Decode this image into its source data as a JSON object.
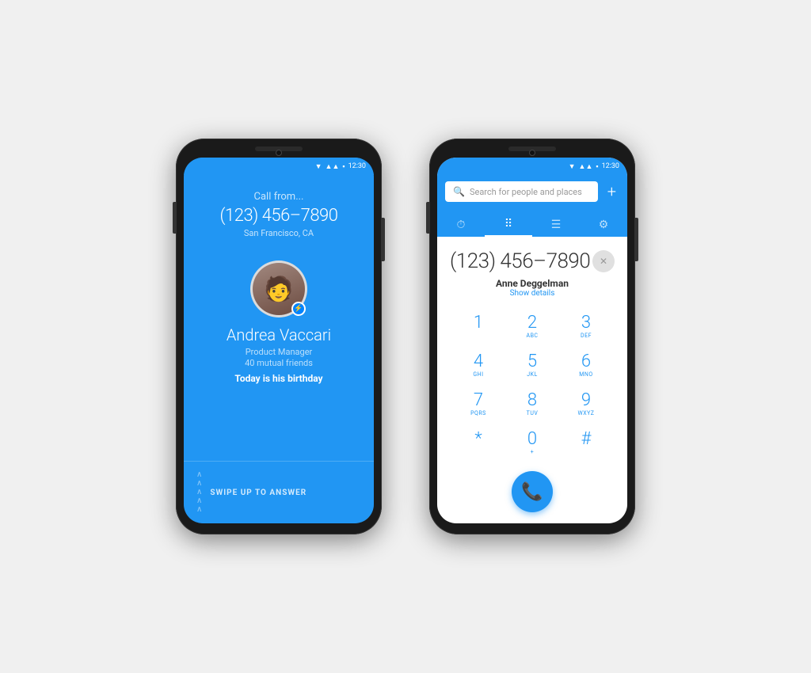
{
  "phone1": {
    "statusBar": {
      "time": "12:30",
      "wifiIcon": "▼",
      "signalIcon": "▲▲",
      "batteryIcon": "🔋"
    },
    "callFrom": "Call from...",
    "phoneNumber": "(123) 456–7890",
    "location": "San Francisco, CA",
    "avatar": "😄",
    "callerName": "Andrea Vaccari",
    "callerTitle": "Product Manager",
    "callerMutual": "40 mutual friends",
    "callerBirthday": "Today is his birthday",
    "swipeText": "SWIPE UP TO ANSWER",
    "messengerBadge": "m"
  },
  "phone2": {
    "statusBar": {
      "time": "12:30"
    },
    "searchPlaceholder": "Search for people and places",
    "addLabel": "+",
    "tabs": [
      {
        "id": "recents",
        "icon": "⏱",
        "active": false
      },
      {
        "id": "dialer",
        "icon": "⠿",
        "active": true
      },
      {
        "id": "contacts",
        "icon": "☰",
        "active": false
      },
      {
        "id": "settings",
        "icon": "⚙",
        "active": false
      }
    ],
    "dialedNumber": "(123) 456–7890",
    "contactName": "Anne Deggelman",
    "showDetails": "Show details",
    "keys": [
      {
        "digit": "1",
        "letters": ""
      },
      {
        "digit": "2",
        "letters": "ABC"
      },
      {
        "digit": "3",
        "letters": "DEF"
      },
      {
        "digit": "4",
        "letters": "GHI"
      },
      {
        "digit": "5",
        "letters": "JKL"
      },
      {
        "digit": "6",
        "letters": "MNO"
      },
      {
        "digit": "7",
        "letters": "PQRS"
      },
      {
        "digit": "8",
        "letters": "TUV"
      },
      {
        "digit": "9",
        "letters": "WXYZ"
      },
      {
        "digit": "*",
        "letters": ""
      },
      {
        "digit": "0",
        "letters": "+"
      },
      {
        "digit": "#",
        "letters": ""
      }
    ]
  }
}
